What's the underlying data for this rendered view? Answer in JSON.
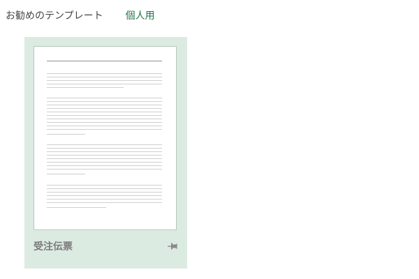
{
  "tabs": {
    "featured_label": "お勧めのテンプレート",
    "personal_label": "個人用"
  },
  "template_card": {
    "title": "受注伝票"
  },
  "icons": {
    "pin": "pin-icon"
  },
  "colors": {
    "accent": "#217346",
    "card_bg": "#dcebe2"
  }
}
